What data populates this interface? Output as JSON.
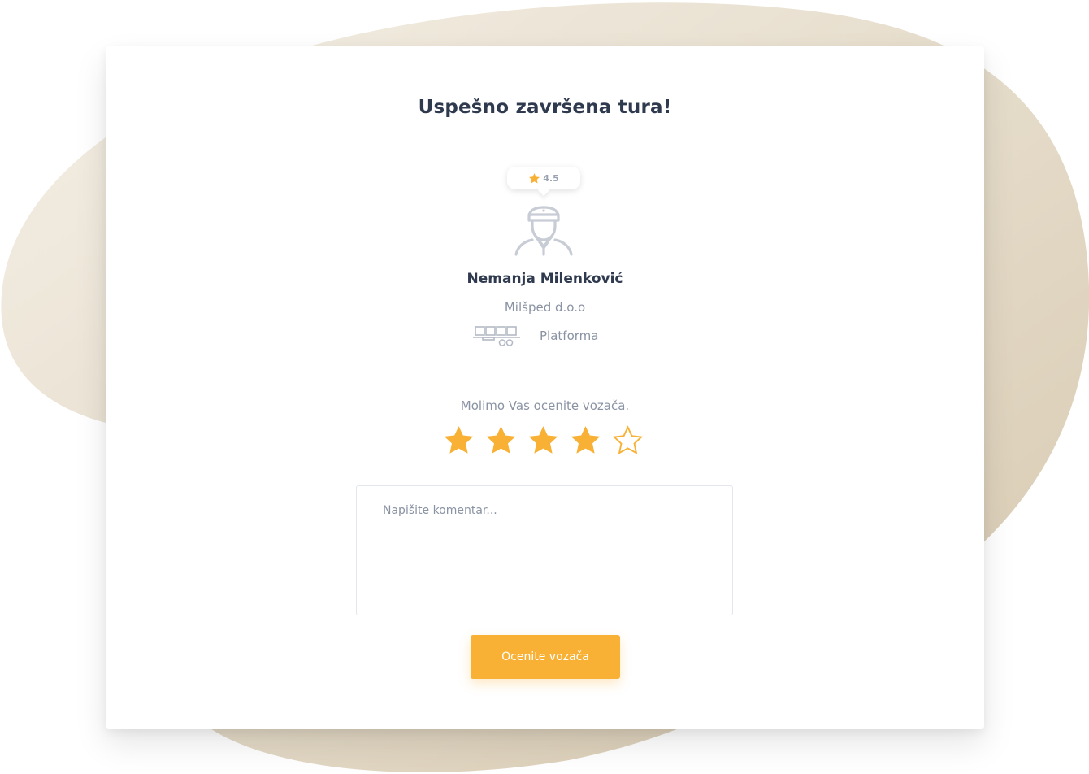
{
  "page": {
    "title": "Uspešno završena tura!"
  },
  "driver": {
    "rating": "4.5",
    "name": "Nemanja Milenković",
    "company": "Milšped d.o.o",
    "vehicle_type": "Platforma",
    "avatar_icon": "driver-avatar-icon",
    "vehicle_icon": "platform-trailer-icon"
  },
  "rating_form": {
    "prompt": "Molimo Vas ocenite vozača.",
    "selected_stars": 4,
    "max_stars": 5,
    "comment_placeholder": "Napišite komentar...",
    "comment_value": "",
    "submit_label": "Ocenite vozača"
  },
  "colors": {
    "accent": "#f8b135",
    "text_dark": "#2f3a4f",
    "text_muted": "#8a93a3",
    "blob_light": "#f4efe6",
    "blob_dark": "#d8cbb2"
  }
}
